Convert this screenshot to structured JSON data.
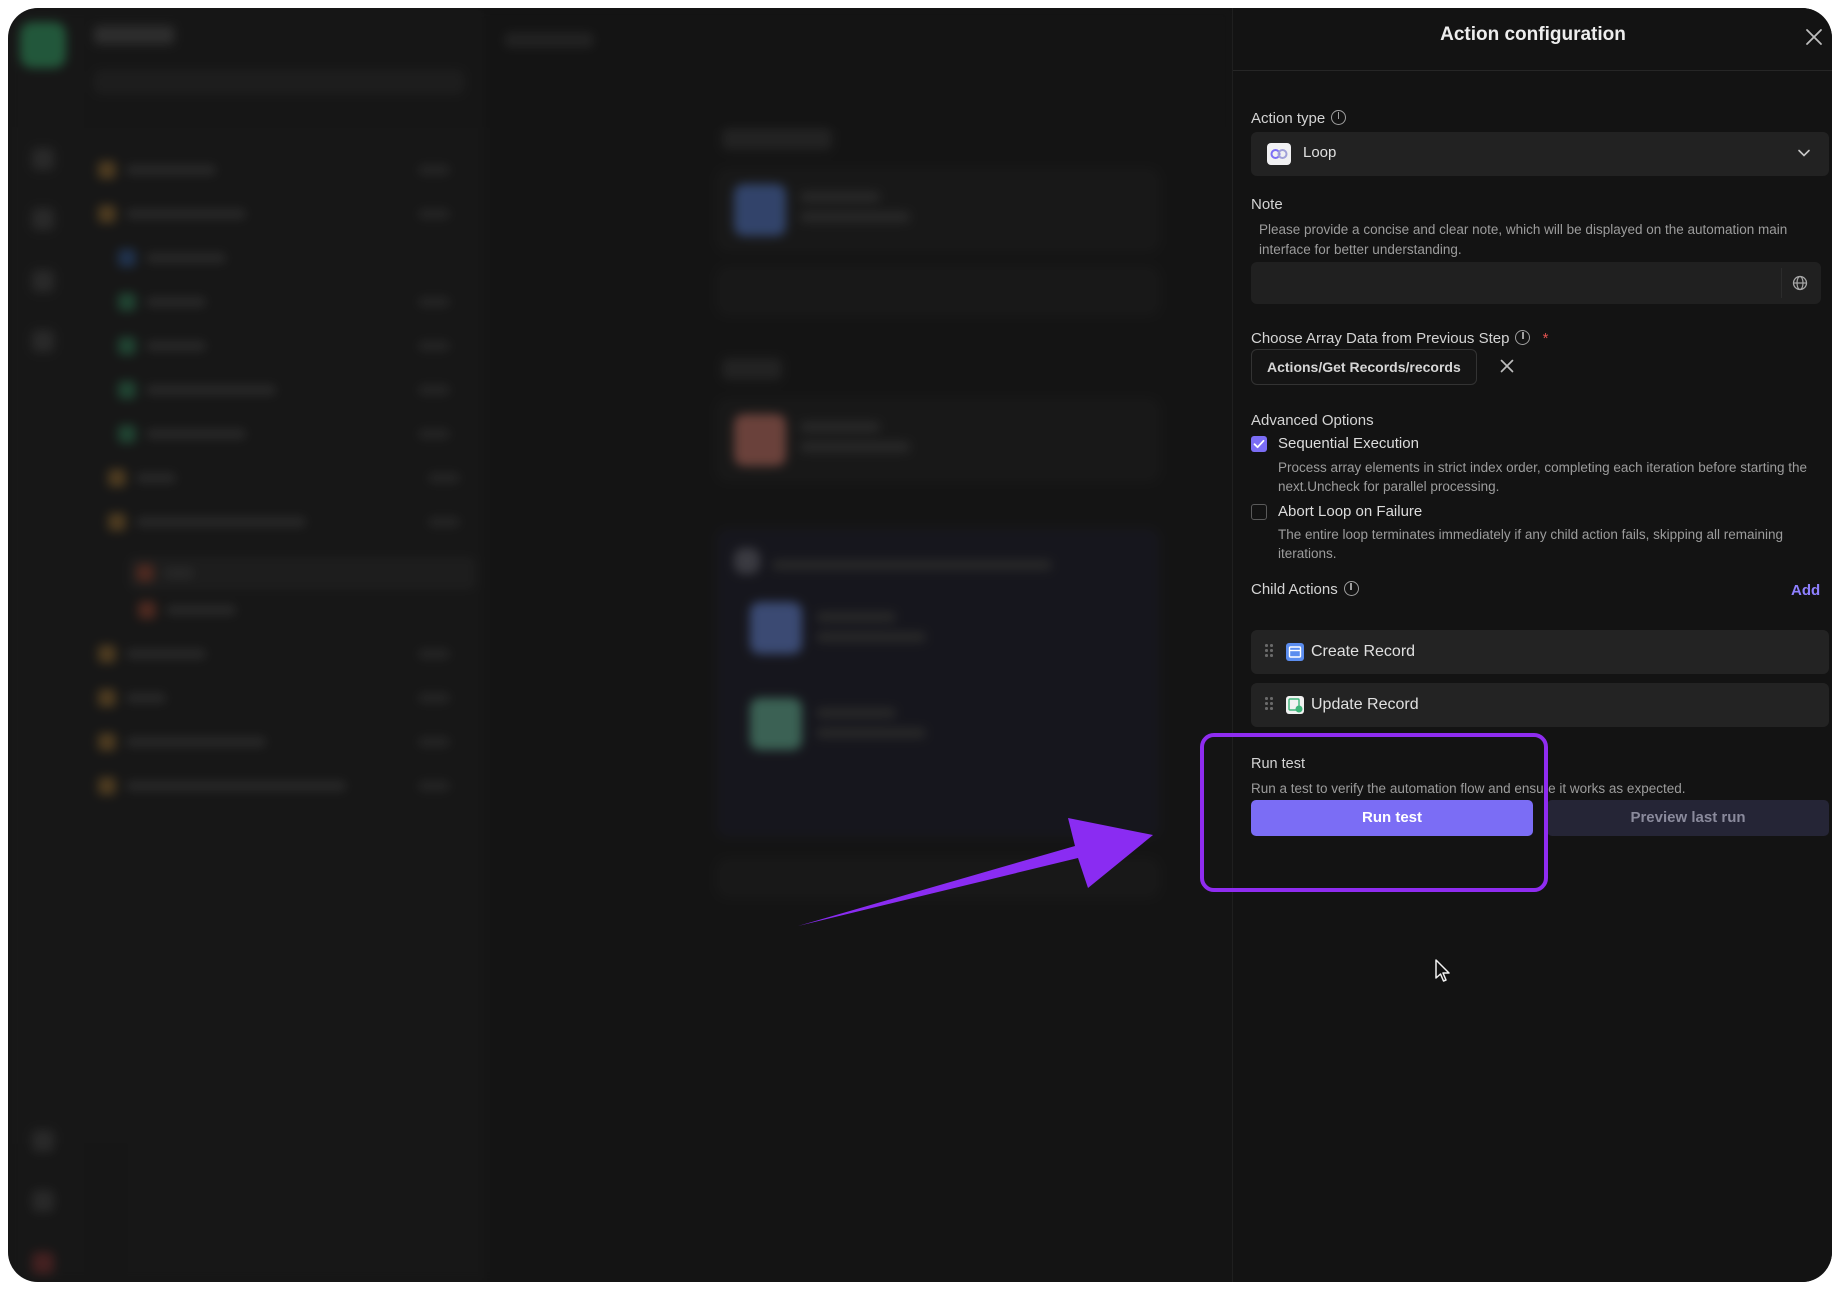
{
  "panel": {
    "title": "Action configuration",
    "action_type": {
      "label": "Action type",
      "icon": "loop-icon",
      "value": "Loop"
    },
    "note": {
      "label": "Note",
      "description": "Please provide a concise and clear note, which will be displayed on the automation main interface for better understanding.",
      "value": ""
    },
    "array_source": {
      "label": "Choose Array Data from Previous Step",
      "required_mark": "*",
      "chip": "Actions/Get Records/records"
    },
    "advanced": {
      "label": "Advanced Options",
      "options": [
        {
          "label": "Sequential Execution",
          "checked": true,
          "description": "Process array elements in strict index order, completing each iteration before starting the next.Uncheck for parallel processing."
        },
        {
          "label": "Abort Loop on Failure",
          "checked": false,
          "description": "The entire loop terminates immediately if any child action fails, skipping all remaining iterations."
        }
      ]
    },
    "child_actions": {
      "label": "Child Actions",
      "add_label": "Add",
      "items": [
        {
          "name": "Create Record",
          "icon": "create-record-icon",
          "icon_color": "#5b8def"
        },
        {
          "name": "Update Record",
          "icon": "update-record-icon",
          "icon_color": "#3fb57a"
        }
      ]
    },
    "run_test": {
      "label": "Run test",
      "description": "Run a test to verify the automation flow and ensure it works as expected.",
      "run_button": "Run test",
      "preview_button": "Preview last run"
    }
  },
  "colors": {
    "accent": "#7b6df5",
    "highlight": "#8f2cf0",
    "panel_bg": "#131313"
  }
}
